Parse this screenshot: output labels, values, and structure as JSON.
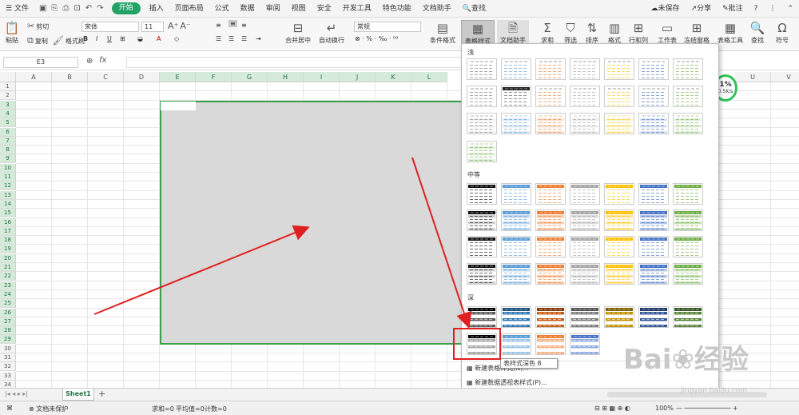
{
  "menubar": {
    "file": "文件",
    "items": [
      "开始",
      "插入",
      "页面布局",
      "公式",
      "数据",
      "审阅",
      "视图",
      "安全",
      "开发工具",
      "特色功能",
      "文档助手"
    ],
    "active_index": 0,
    "search": "查找",
    "unsaved": "未保存",
    "share": "分享",
    "comment": "批注"
  },
  "toolbar": {
    "paste": "粘贴",
    "cut": "剪切",
    "copy": "复制",
    "format_painter": "格式刷",
    "font_name": "宋体",
    "font_size": "11",
    "merge_center": "合并居中",
    "wrap_text": "自动换行",
    "number_format": "常规",
    "cond_format": "条件格式",
    "table_style": "表格样式",
    "doc_helper": "文档助手",
    "sum": "求和",
    "filter": "筛选",
    "sort": "排序",
    "format": "格式",
    "rows_cols": "行和列",
    "worksheet": "工作表",
    "freeze": "冻结窗格",
    "table_tools": "表格工具",
    "find": "查找",
    "symbol": "符号"
  },
  "formula": {
    "cell_ref": "E3",
    "fx": "fx"
  },
  "grid": {
    "columns": [
      "A",
      "B",
      "C",
      "D",
      "E",
      "F",
      "G",
      "H",
      "I",
      "J",
      "K",
      "L",
      "U",
      "V"
    ],
    "rows": [
      "1",
      "2",
      "3",
      "4",
      "5",
      "6",
      "7",
      "8",
      "9",
      "10",
      "11",
      "12",
      "13",
      "14",
      "15",
      "16",
      "17",
      "18",
      "19",
      "20",
      "21",
      "22",
      "23",
      "24",
      "25",
      "26",
      "27",
      "28",
      "29",
      "30",
      "31",
      "32",
      "33",
      "34"
    ],
    "selected_rows_from": 3,
    "selected_rows_to": 29
  },
  "dropdown": {
    "light": "浅",
    "medium": "中等",
    "dark": "深",
    "new_table_style": "新建表格样式(N)...",
    "new_pivot_style": "新建数据透视表样式(P)...",
    "tooltip": "表样式深色 8"
  },
  "sheet": {
    "tab": "Sheet1",
    "add": "+"
  },
  "status": {
    "protect": "文档未保护",
    "sum": "求和=0",
    "avg": "平均值=0",
    "count": "计数=0",
    "zoom": "100%"
  },
  "speed": {
    "percent": "1%",
    "rate": "0.5K/s"
  },
  "watermark": {
    "brand": "Bai",
    "brand_cn": "经验",
    "url": "jingyan.baidu.com"
  },
  "colors": {
    "accent": "#21a366",
    "selection_border": "#3aa14a",
    "highlight": "#e02020"
  }
}
